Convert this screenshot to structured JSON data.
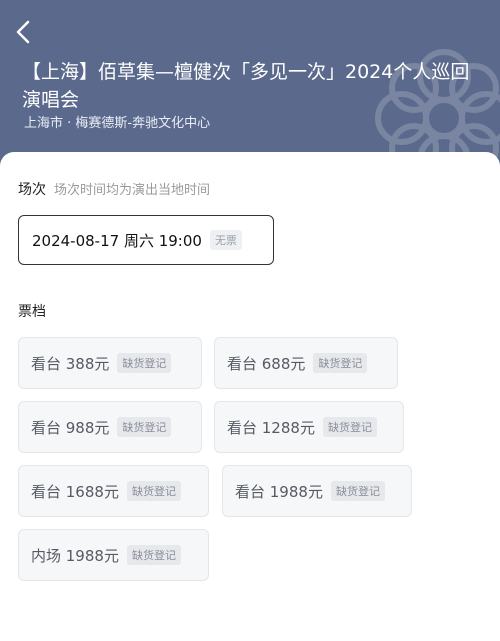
{
  "header": {
    "title": "【上海】佰草集—檀健次「多见一次」2024个人巡回演唱会",
    "venue": "上海市 · 梅赛德斯-奔驰文化中心",
    "colors": {
      "header_bg": "#5b6a8c",
      "accent_text": "#ffffff"
    }
  },
  "session": {
    "label": "场次",
    "hint": "场次时间均为演出当地时间",
    "selected": {
      "text": "2024-08-17  周六 19:00",
      "badge": "无票"
    }
  },
  "tickets": {
    "label": "票档",
    "items": [
      {
        "name": "看台 388元",
        "badge": "缺货登记"
      },
      {
        "name": "看台 688元",
        "badge": "缺货登记"
      },
      {
        "name": "看台 988元",
        "badge": "缺货登记"
      },
      {
        "name": "看台 1288元",
        "badge": "缺货登记"
      },
      {
        "name": "看台 1688元",
        "badge": "缺货登记"
      },
      {
        "name": "看台 1988元",
        "badge": "缺货登记"
      },
      {
        "name": "内场 1988元",
        "badge": "缺货登记"
      }
    ]
  },
  "icons": {
    "back": "chevron-left-icon",
    "decoration": "flower-pattern-icon"
  }
}
